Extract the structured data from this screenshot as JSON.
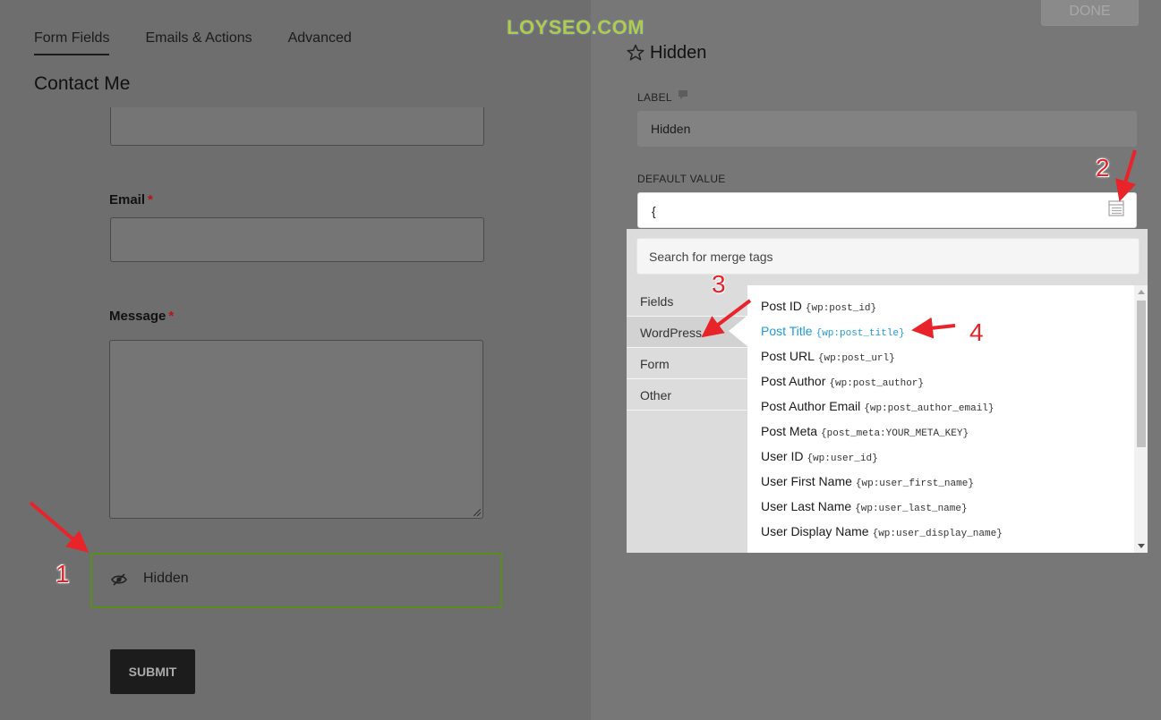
{
  "tabs": [
    {
      "label": "Form Fields",
      "active": true
    },
    {
      "label": "Emails & Actions",
      "active": false
    },
    {
      "label": "Advanced",
      "active": false
    }
  ],
  "form": {
    "title": "Contact Me",
    "fields": [
      {
        "label": "Email",
        "required": true
      },
      {
        "label": "Message",
        "required": true
      }
    ],
    "required_mark": "*",
    "hidden_field_label": "Hidden",
    "submit_label": "SUBMIT"
  },
  "settings": {
    "done_label": "DONE",
    "watermark": "LOYSEO.COM",
    "field_type": "Hidden",
    "label_caption": "LABEL",
    "label_value": "Hidden",
    "default_caption": "DEFAULT VALUE",
    "default_value": "{",
    "search_placeholder": "Search for merge tags",
    "categories": [
      {
        "label": "Fields",
        "active": false
      },
      {
        "label": "WordPress",
        "active": true
      },
      {
        "label": "Form",
        "active": false
      },
      {
        "label": "Other",
        "active": false
      }
    ],
    "merge_tags": [
      {
        "name": "Post ID",
        "code": "{wp:post_id}"
      },
      {
        "name": "Post Title",
        "code": "{wp:post_title}",
        "highlight": true
      },
      {
        "name": "Post URL",
        "code": "{wp:post_url}"
      },
      {
        "name": "Post Author",
        "code": "{wp:post_author}"
      },
      {
        "name": "Post Author Email",
        "code": "{wp:post_author_email}"
      },
      {
        "name": "Post Meta",
        "code": "{post_meta:YOUR_META_KEY}"
      },
      {
        "name": "User ID",
        "code": "{wp:user_id}"
      },
      {
        "name": "User First Name",
        "code": "{wp:user_first_name}"
      },
      {
        "name": "User Last Name",
        "code": "{wp:user_last_name}"
      },
      {
        "name": "User Display Name",
        "code": "{wp:user_display_name}"
      }
    ]
  },
  "annotations": [
    "1",
    "2",
    "3",
    "4"
  ],
  "colors": {
    "annotation_red": "#e8232a",
    "highlight_blue": "#1e9bd6",
    "selected_field_border": "#5a8d20"
  },
  "icons": {
    "hidden_field": "eye-slash-icon",
    "field_type": "star-icon",
    "label_help": "comment-icon",
    "merge_tags": "list-icon"
  }
}
